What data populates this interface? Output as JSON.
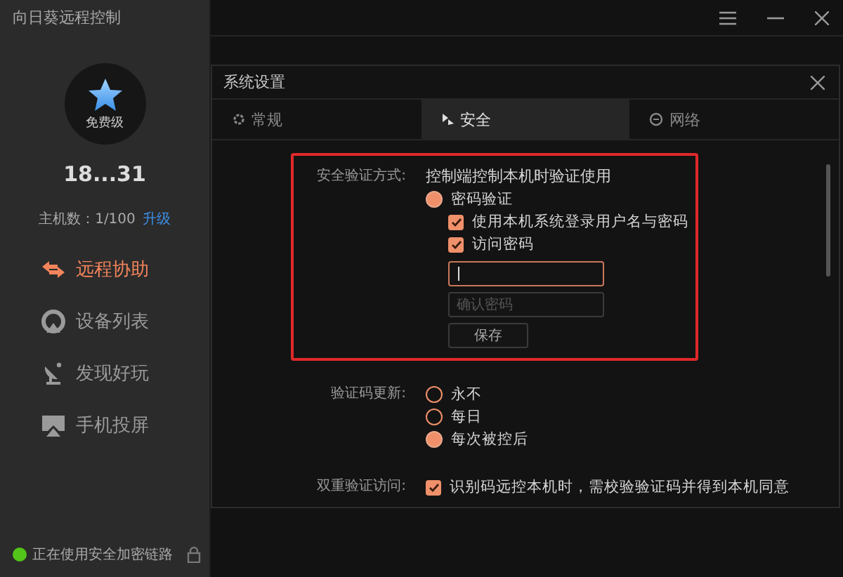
{
  "app": {
    "title": "向日葵远程控制"
  },
  "account": {
    "tier": "免费级",
    "user": "18...31",
    "hosts": "主机数：1/100",
    "upgrade_link": "升级"
  },
  "nav": [
    {
      "kind": "remote",
      "label": "远程协助",
      "selected": true
    },
    {
      "kind": "devices",
      "label": "设备列表",
      "selected": false
    },
    {
      "kind": "discover",
      "label": "发现好玩",
      "selected": false
    },
    {
      "kind": "cast",
      "label": "手机投屏",
      "selected": false
    }
  ],
  "status": {
    "text": "正在使用安全加密链路",
    "connected": true
  },
  "dialog": {
    "title": "系统设置",
    "tabs": [
      {
        "kind": "general",
        "label": "常规",
        "selected": false
      },
      {
        "kind": "security",
        "label": "安全",
        "selected": true
      },
      {
        "kind": "network",
        "label": "网络",
        "selected": false
      }
    ],
    "verification": {
      "highlighted": true,
      "label": "安全验证方式:",
      "description": "控制端控制本机时验证使用",
      "method": {
        "label": "密码验证",
        "selected": true
      },
      "options": [
        {
          "label": "使用本机系统登录用户名与密码",
          "checked": true
        },
        {
          "label": "访问密码",
          "checked": true
        }
      ],
      "password": {
        "focused": true
      },
      "confirm": {
        "placeholder": "确认密码"
      },
      "save_button": "保存"
    },
    "code_update": {
      "label": "验证码更新:",
      "options": [
        {
          "label": "永不",
          "selected": false
        },
        {
          "label": "每日",
          "selected": false
        },
        {
          "label": "每次被控后",
          "selected": true
        }
      ]
    },
    "two_factor": {
      "label": "双重验证访问:",
      "checked": true,
      "text": "识别码远控本机时，需校验验证码并得到本机同意"
    }
  }
}
